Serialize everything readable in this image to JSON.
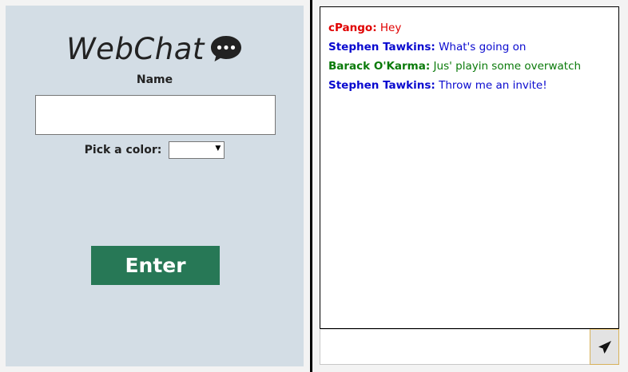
{
  "login": {
    "app_title": "WebChat",
    "logo_icon": "chat-bubble-icon",
    "name_label": "Name",
    "name_value": "",
    "color_label": "Pick a color:",
    "color_selected": "",
    "enter_label": "Enter",
    "panel_color": "#d3dde5",
    "button_color": "#277856"
  },
  "chat": {
    "messages": [
      {
        "author": "cPango:",
        "text": " Hey",
        "color": "#e00000"
      },
      {
        "author": "Stephen Tawkins:",
        "text": " What's going on",
        "color": "#0a0acf"
      },
      {
        "author": "Barack O'Karma:",
        "text": " Jus' playin some overwatch",
        "color": "#0a7a0a"
      },
      {
        "author": "Stephen Tawkins:",
        "text": " Throw me an invite!",
        "color": "#0a0acf"
      }
    ],
    "input_value": "",
    "send_icon": "paper-plane-icon"
  }
}
